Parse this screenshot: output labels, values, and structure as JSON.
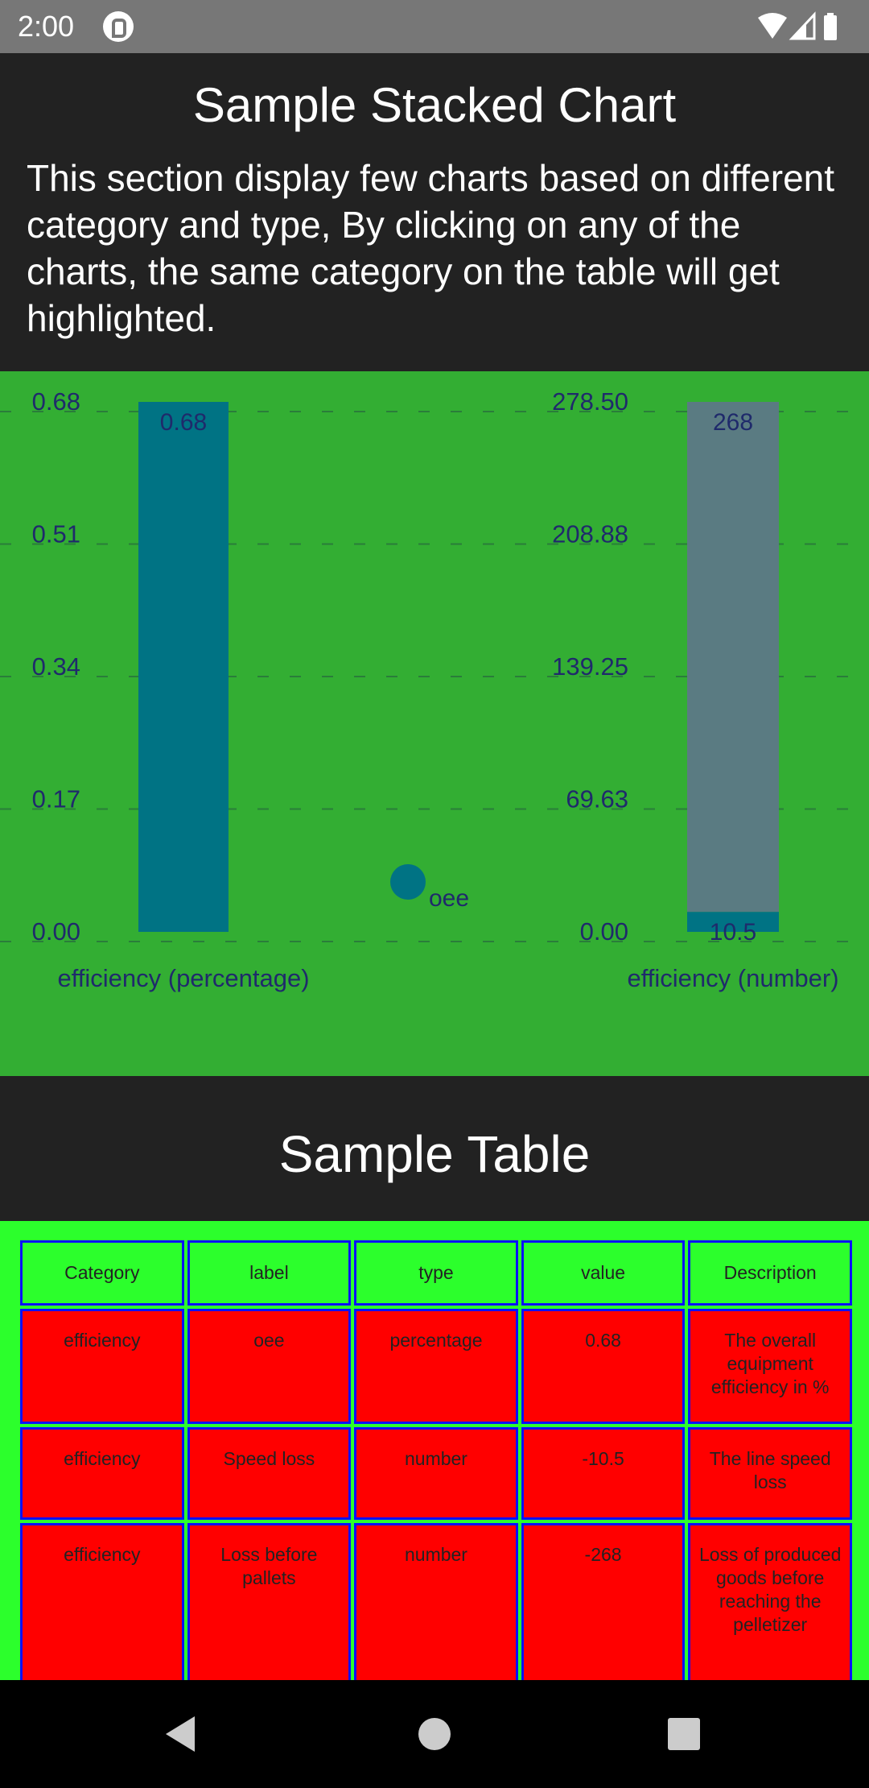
{
  "status_bar": {
    "time": "2:00",
    "icons": [
      "app-notification-icon",
      "wifi-icon",
      "cell-signal-icon",
      "battery-icon"
    ]
  },
  "header": {
    "title": "Sample Stacked Chart",
    "description": "This section display few charts based on different category and type, By clicking on any of the charts, the same category on the table will get highlighted."
  },
  "chart_data": [
    {
      "type": "bar",
      "categories": [
        "efficiency (percentage)"
      ],
      "series": [
        {
          "name": "oee",
          "values": [
            0.68
          ],
          "color": "#007384"
        }
      ],
      "data_labels": [
        "0.68"
      ],
      "ylim": [
        0,
        0.68
      ],
      "yticks": [
        "0.00",
        "0.17",
        "0.34",
        "0.51",
        "0.68"
      ],
      "grid": true,
      "legend": [
        {
          "label": "oee",
          "color": "#007384"
        }
      ],
      "legend_position": "bottom-center"
    },
    {
      "type": "bar",
      "categories": [
        "efficiency (number)"
      ],
      "series": [
        {
          "values": [
            10.5
          ],
          "color": "#007384"
        },
        {
          "values": [
            268
          ],
          "color": "#5a7b82"
        }
      ],
      "data_labels": [
        "10.5",
        "268"
      ],
      "ylim": [
        0,
        278.5
      ],
      "yticks": [
        "0.00",
        "69.63",
        "139.25",
        "208.88",
        "278.50"
      ],
      "grid": true
    }
  ],
  "table_section": {
    "title": "Sample Table",
    "headers": [
      "Category",
      "label",
      "type",
      "value",
      "Description"
    ],
    "rows": [
      [
        "efficiency",
        "oee",
        "percentage",
        "0.68",
        "The overall equipment efficiency in %"
      ],
      [
        "efficiency",
        "Speed loss",
        "number",
        "-10.5",
        "The line speed loss"
      ],
      [
        "efficiency",
        "Loss before pallets",
        "number",
        "-268",
        "Loss of produced goods before reaching the pelletizer"
      ],
      [
        "",
        "",
        "",
        "",
        ""
      ]
    ]
  },
  "nav_bar": {
    "buttons": [
      "back-icon",
      "home-icon",
      "recents-icon"
    ]
  },
  "colors": {
    "status_bar": "#777777",
    "panel_background": "#222222",
    "chart_background": "#33ae33",
    "bar_primary": "#007384",
    "bar_secondary": "#5a7b82",
    "axis_text": "#1f2a6b",
    "table_background": "#2cff2c",
    "table_cell": "#ff0000",
    "table_border": "#0a10ff"
  }
}
